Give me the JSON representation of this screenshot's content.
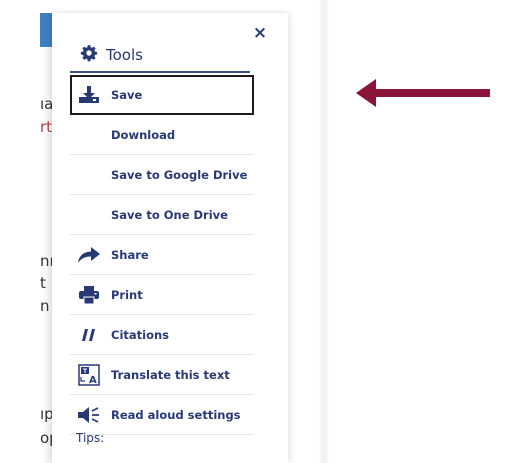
{
  "panel": {
    "title": "Tools",
    "close_symbol": "×",
    "items": [
      {
        "label": "Save",
        "icon": "download-icon"
      },
      {
        "label": "Download",
        "icon": ""
      },
      {
        "label": "Save to Google Drive",
        "icon": ""
      },
      {
        "label": "Save to One Drive",
        "icon": ""
      },
      {
        "label": "Share",
        "icon": "share-arrow-icon"
      },
      {
        "label": "Print",
        "icon": "printer-icon"
      },
      {
        "label": "Citations",
        "icon": "quote-icon"
      },
      {
        "label": "Translate this text",
        "icon": "translate-icon"
      },
      {
        "label": "Read aloud settings",
        "icon": "speaker-icon"
      }
    ],
    "tips_label": "Tips:"
  },
  "background": {
    "fragments": [
      "ıa",
      "rt",
      "nı",
      "t",
      "n",
      "ıp",
      "op"
    ]
  },
  "colors": {
    "accent": "#3e7fbf",
    "text": "#283a73",
    "arrow": "#8b1538"
  }
}
